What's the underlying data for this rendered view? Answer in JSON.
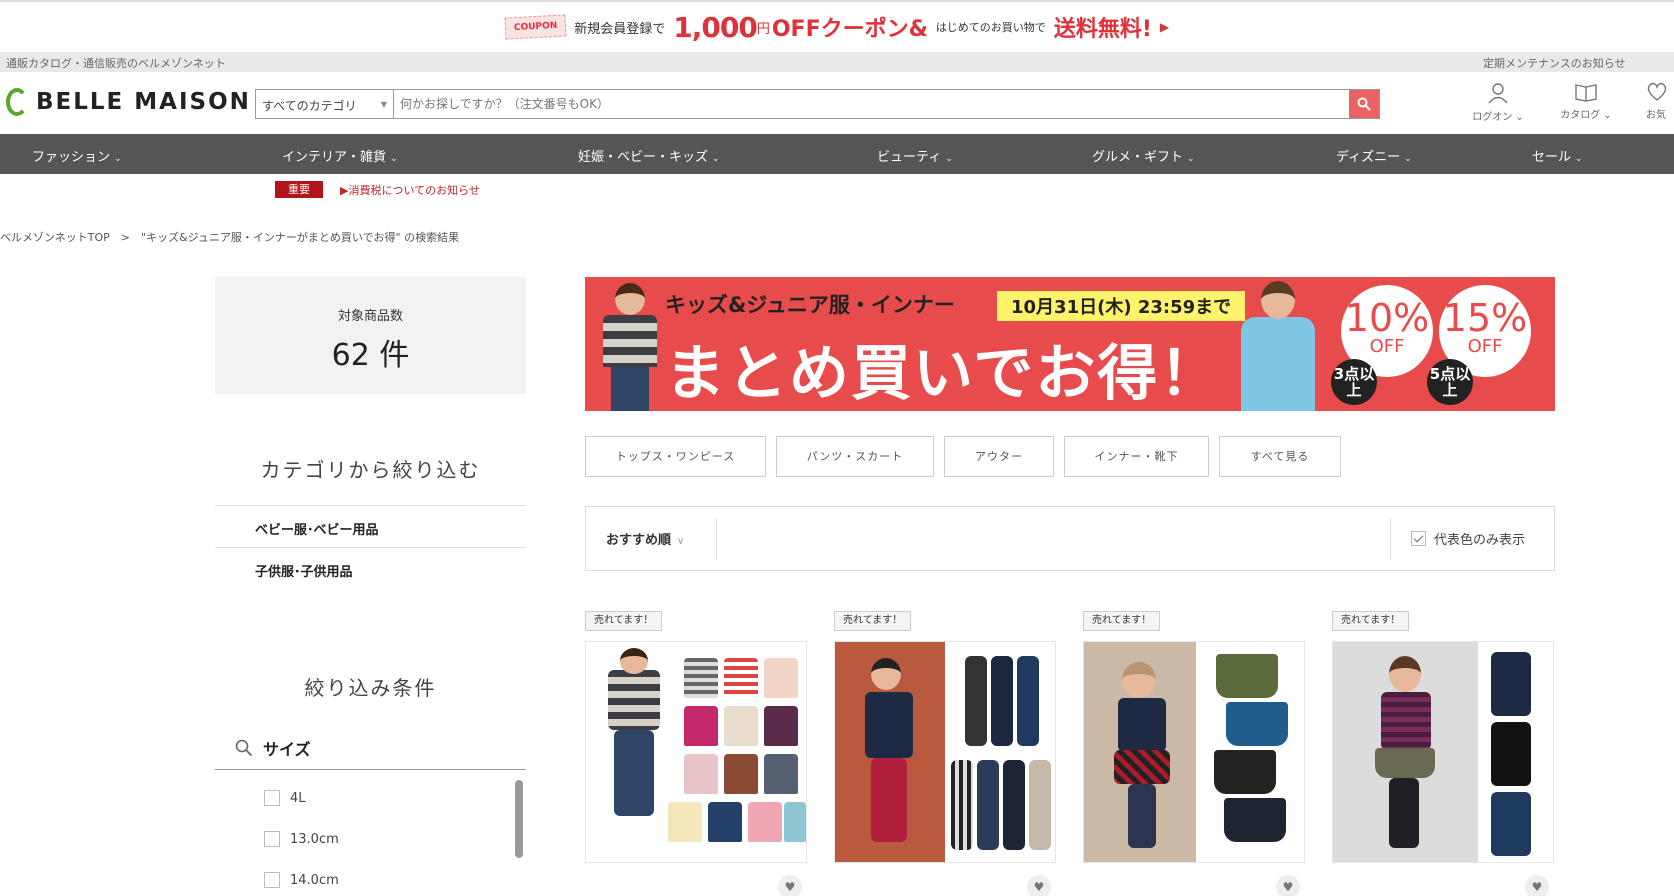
{
  "promo": {
    "coupon": "COUPON",
    "text1": "新規会員登録で",
    "amount": "1,000",
    "yen": "円",
    "off": "OFFクーポン&",
    "text2": "はじめてのお買い物で",
    "free": "送料無料!",
    "arrow": "▶"
  },
  "utility": {
    "left": "通販カタログ・通信販売のベルメゾンネット",
    "right": "定期メンテナンスのお知らせ"
  },
  "header": {
    "logo": "BELLE MAISON",
    "search_category": "すべてのカテゴリ",
    "search_placeholder": "何かお探しですか？（注文番号もOK）",
    "login": "ログオン ⌄",
    "catalog": "カタログ ⌄",
    "fav": "お気"
  },
  "nav": [
    {
      "label": "ファッション"
    },
    {
      "label": "インテリア・雑貨"
    },
    {
      "label": "妊娠・ベビー・キッズ"
    },
    {
      "label": "ビューティ"
    },
    {
      "label": "グルメ・ギフト"
    },
    {
      "label": "ディズニー"
    },
    {
      "label": "セール"
    }
  ],
  "notice": {
    "badge": "重要",
    "link": "▶消費税についてのお知らせ"
  },
  "breadcrumb": "ベルメゾンネットTOP　>　\"キッズ&ジュニア服・インナーがまとめ買いでお得\" の検索結果",
  "count": {
    "label": "対象商品数",
    "value": "62 件"
  },
  "category_heading": "カテゴリから絞り込む",
  "categories": [
    "ベビー服･ベビー用品",
    "子供服･子供用品"
  ],
  "filter_heading": "絞り込み条件",
  "size": {
    "title": "サイズ",
    "options": [
      "4L",
      "13.0cm",
      "14.0cm"
    ]
  },
  "hero": {
    "title": "キッズ&ジュニア服・インナー",
    "deadline": "10月31日(木) 23:59まで",
    "main": "まとめ買いでお得！",
    "offers": [
      {
        "pct": "10%",
        "off": "OFF",
        "cond": "3点以上"
      },
      {
        "pct": "15%",
        "off": "OFF",
        "cond": "5点以上"
      }
    ]
  },
  "chips": [
    "トップス・ワンピース",
    "パンツ・スカート",
    "アウター",
    "インナー・靴下",
    "すべて見る"
  ],
  "sort": {
    "label": "おすすめ順",
    "rep_color": "代表色のみ表示"
  },
  "products": [
    {
      "badge": "売れてます！"
    },
    {
      "badge": "売れてます！"
    },
    {
      "badge": "売れてます！"
    },
    {
      "badge": "売れてます！"
    }
  ],
  "colors": {
    "accent": "#e0313a",
    "nav_bg": "#555555",
    "hero_bg": "#e84b4b",
    "search_btn": "#e96363",
    "logo_green": "#5aa52a"
  }
}
